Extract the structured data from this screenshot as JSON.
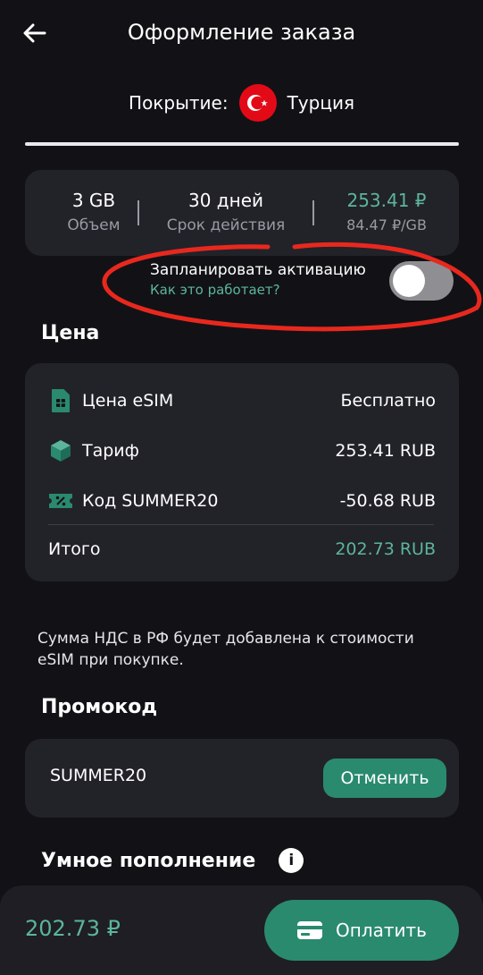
{
  "header": {
    "title": "Оформление заказа"
  },
  "coverage": {
    "label": "Покрытие:",
    "country": "Турция"
  },
  "summary": {
    "volume_value": "3 GB",
    "volume_label": "Объем",
    "duration_value": "30 дней",
    "duration_label": "Срок действия",
    "price_value": "253.41 ₽",
    "price_per_gb": "84.47 ₽/GB"
  },
  "activation": {
    "label": "Запланировать активацию",
    "link": "Как это работает?",
    "enabled": false
  },
  "price_section": {
    "title": "Цена",
    "rows": [
      {
        "name": "Цена eSIM",
        "value": "Бесплатно",
        "icon": "sim-card-icon"
      },
      {
        "name": "Тариф",
        "value": "253.41 RUB",
        "icon": "package-cube-icon"
      },
      {
        "name": "Код SUMMER20",
        "value": "-50.68 RUB",
        "icon": "discount-ticket-icon"
      }
    ],
    "total_label": "Итого",
    "total_value": "202.73 RUB"
  },
  "vat_note": "Сумма НДС в РФ будет добавлена к стоимости eSIM при покупке.",
  "promo": {
    "title": "Промокод",
    "code": "SUMMER20",
    "cancel_label": "Отменить"
  },
  "smart_topup": {
    "title": "Умное пополнение"
  },
  "footer": {
    "total": "202.73 ₽",
    "pay_label": "Оплатить"
  },
  "colors": {
    "accent": "#2a8a6e",
    "accent_text": "#5cb59b",
    "card": "#222229",
    "background": "#121216",
    "annotation": "#e8281e"
  }
}
